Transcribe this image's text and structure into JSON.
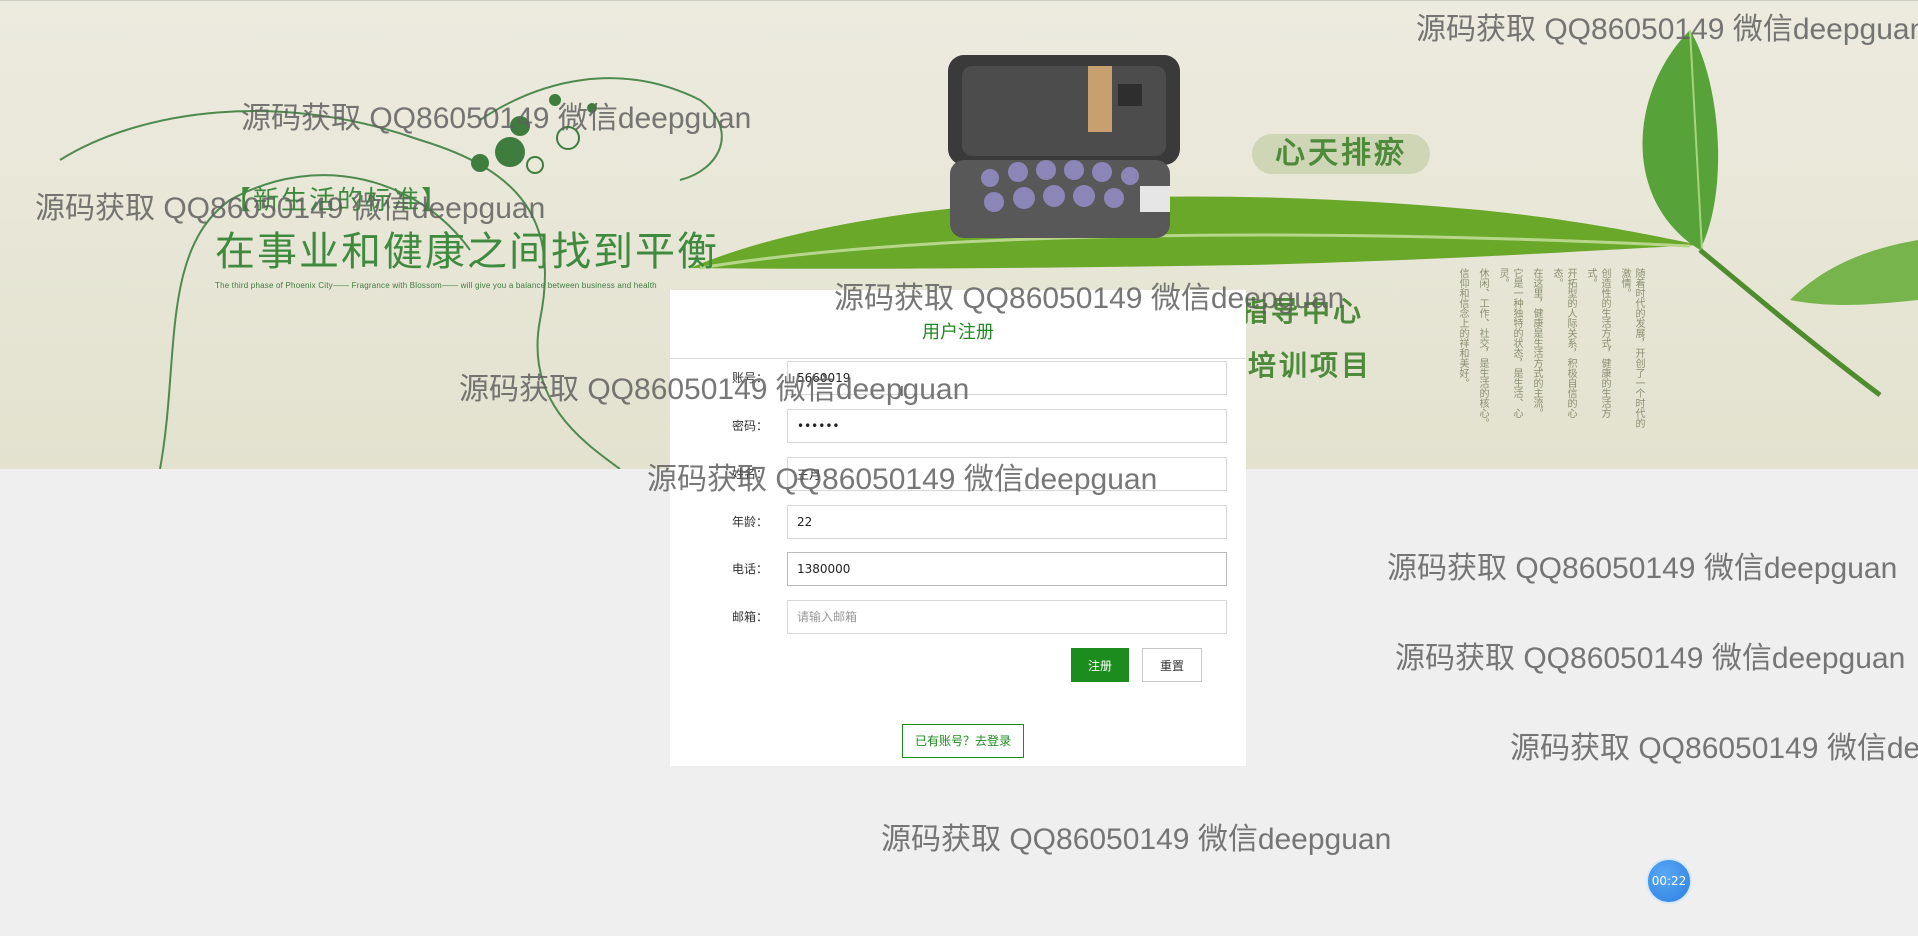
{
  "banner": {
    "slogan_top": "【新生活的标准】",
    "slogan_main": "在事业和健康之间找到平衡",
    "slogan_en": "The third phase of Phoenix City—— Fragrance with Blossom—— will give you a balance between business and health",
    "badge": "心天排瘀",
    "service_center": "指导中心",
    "training": "培训项目",
    "columns": [
      "随着时代的发展，开创了一个时代的激情。",
      "创造性的生活方式，健康的生活方式。",
      "开拓型的人际关系，积极自信的心态。",
      "在这里，健康是生活方式的主流。",
      "它是一种独特的状态，是生活、心灵。",
      "休闲、工作、社交，是生活的核心。",
      "信仰和信念上的祥和美好。"
    ]
  },
  "form": {
    "title": "用户注册",
    "fields": [
      {
        "label": "账号：",
        "value": "5660019",
        "placeholder": ""
      },
      {
        "label": "密码：",
        "value": "••••••",
        "placeholder": ""
      },
      {
        "label": "姓名：",
        "value": "王月",
        "placeholder": ""
      },
      {
        "label": "年龄：",
        "value": "22",
        "placeholder": ""
      },
      {
        "label": "电话：",
        "value": "1380000",
        "placeholder": ""
      },
      {
        "label": "邮箱：",
        "value": "",
        "placeholder": "请输入邮箱"
      }
    ],
    "register_label": "注册",
    "reset_label": "重置",
    "login_link": "已有账号？去登录"
  },
  "watermark_text": "源码获取 QQ86050149 微信deepguan",
  "timer": "00:22",
  "colors": {
    "accent": "#1d8c1f",
    "page_background": "#efefef",
    "timer": "#2b7fe0"
  }
}
